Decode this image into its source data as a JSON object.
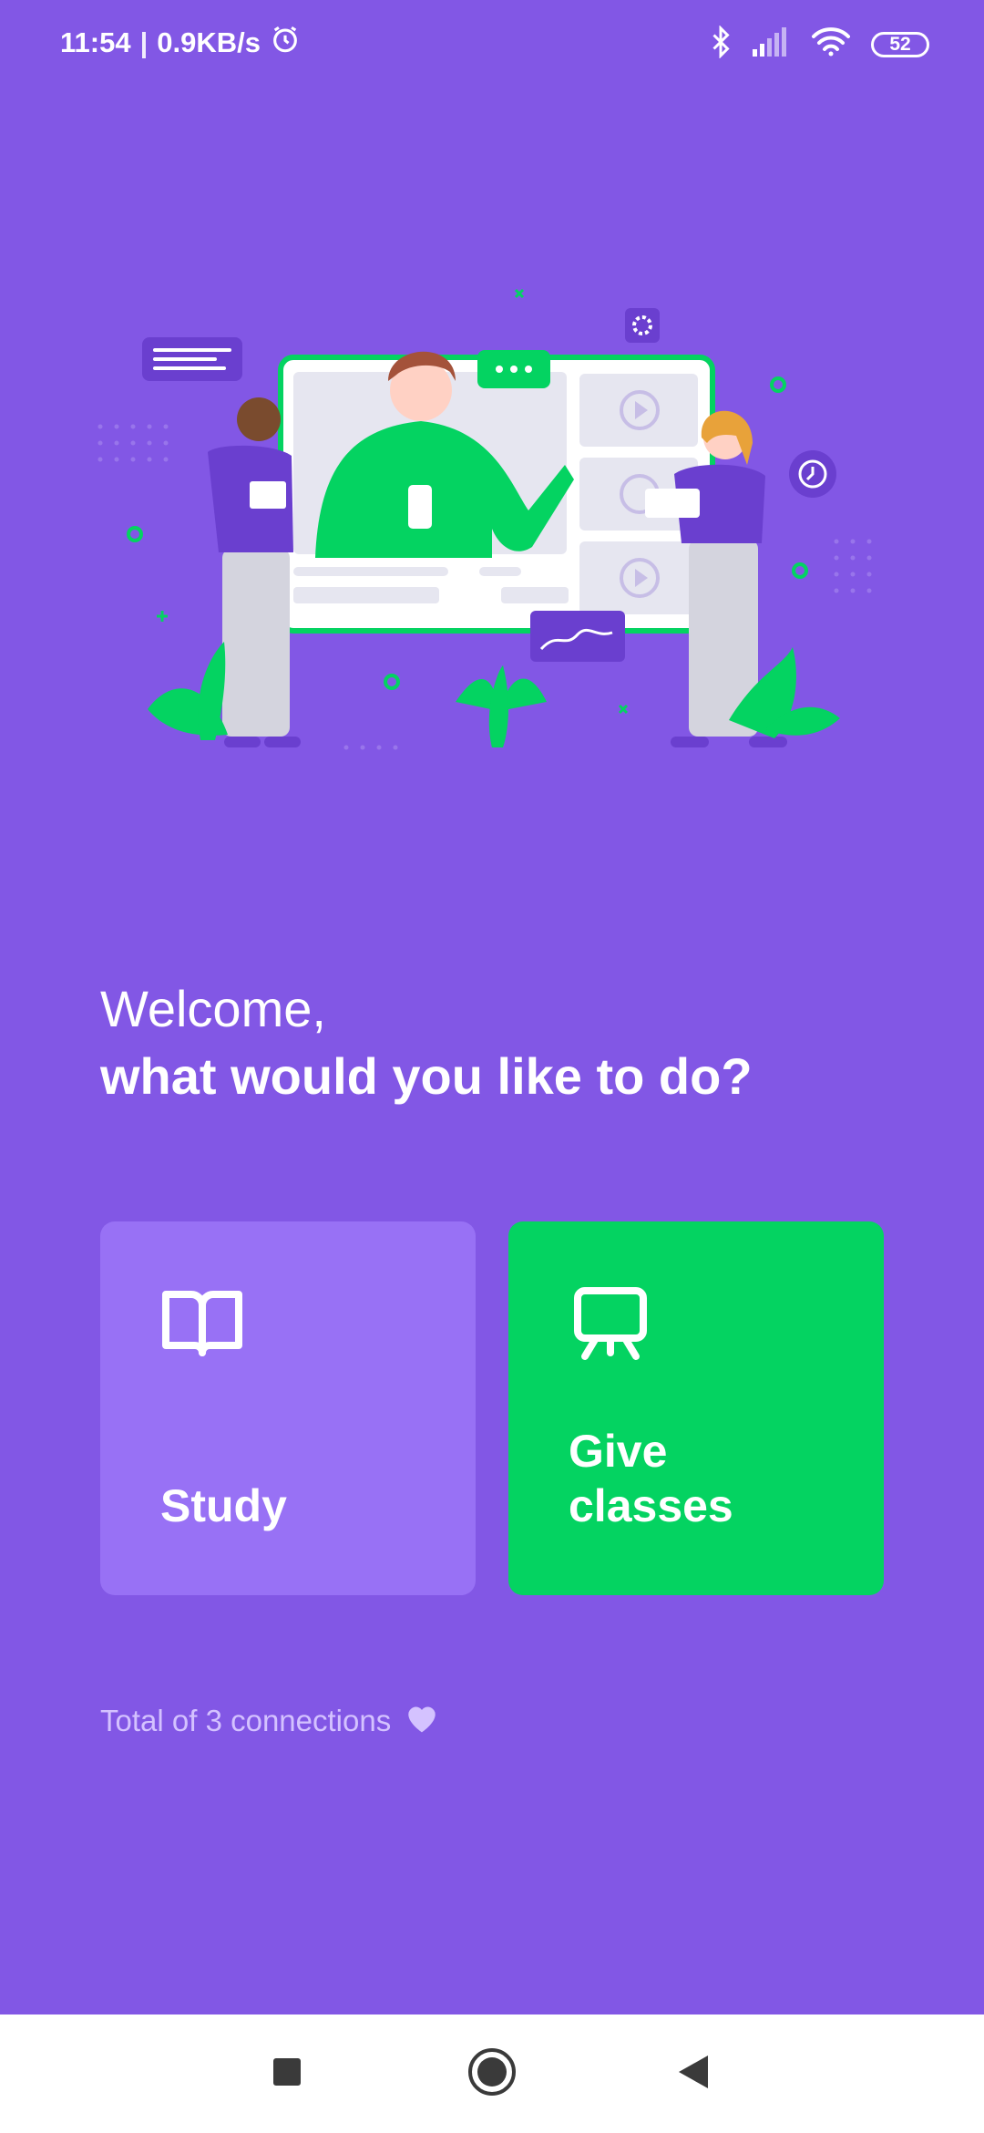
{
  "status_bar": {
    "time": "11:54",
    "separator": "|",
    "network_speed": "0.9KB/s",
    "battery_level": "52",
    "icons": [
      "alarm-icon",
      "bluetooth-icon",
      "signal-icon",
      "wifi-icon",
      "battery-icon"
    ]
  },
  "welcome": {
    "line1": "Welcome,",
    "line2": "what would you like to do?"
  },
  "actions": {
    "study": {
      "label": "Study",
      "icon": "book-icon",
      "color": "#9871F5"
    },
    "give_classes": {
      "label": "Give classes",
      "label_line1": "Give",
      "label_line2": "classes",
      "icon": "presentation-board-icon",
      "color": "#04D361"
    }
  },
  "footer": {
    "connections_text": "Total of 3 connections",
    "heart_icon": "heart-icon"
  },
  "colors": {
    "background": "#8257E5",
    "accent_green": "#04D361",
    "muted_text": "#D4C2FF"
  },
  "navigation": {
    "icons": [
      "recent-apps-icon",
      "home-icon",
      "back-icon"
    ]
  }
}
